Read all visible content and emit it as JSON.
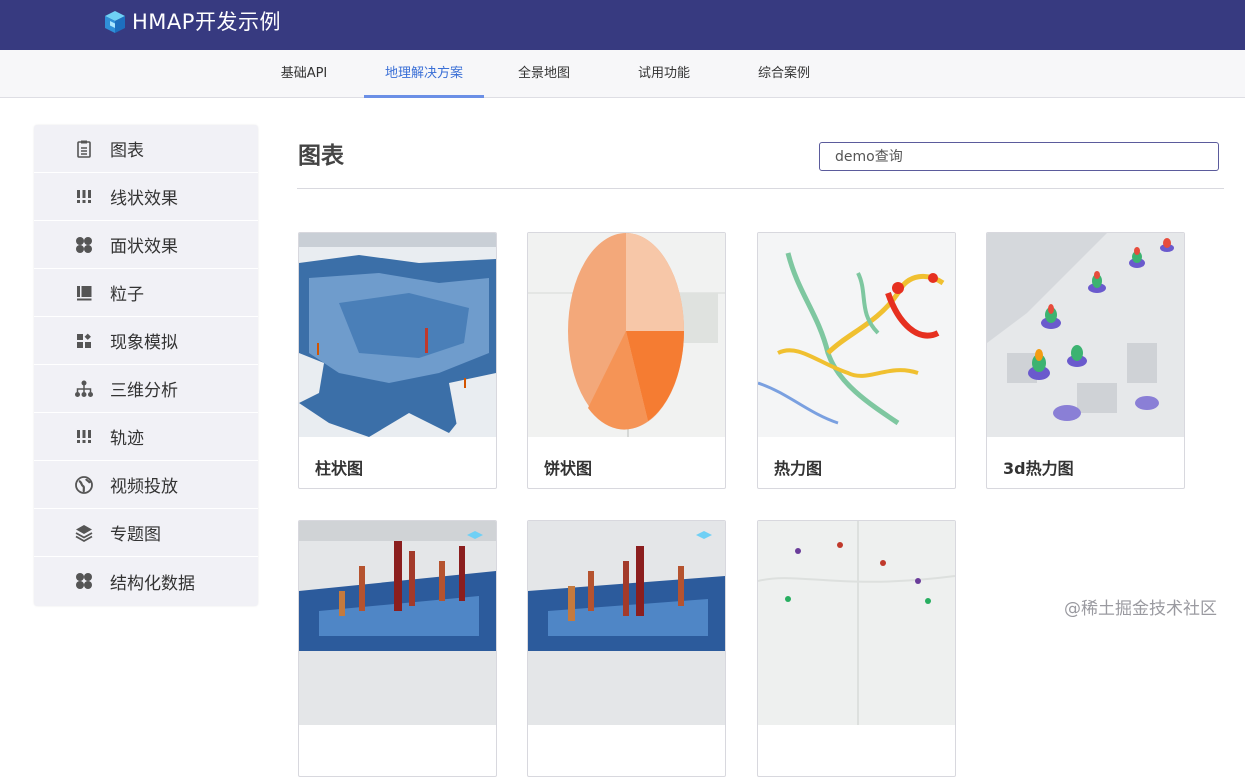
{
  "header": {
    "logo_icon": "cube-logo-icon",
    "title": "HMAP开发示例",
    "brand_color": "#373a80"
  },
  "nav": {
    "tabs": [
      {
        "label": "基础API",
        "active": false
      },
      {
        "label": "地理解决方案",
        "active": true
      },
      {
        "label": "全景地图",
        "active": false
      },
      {
        "label": "试用功能",
        "active": false
      },
      {
        "label": "综合案例",
        "active": false
      }
    ],
    "active_color": "#3a6fd6"
  },
  "sidebar": {
    "items": [
      {
        "label": "图表",
        "icon": "clipboard-icon"
      },
      {
        "label": "线状效果",
        "icon": "dots-grid-icon"
      },
      {
        "label": "面状效果",
        "icon": "clover-icon"
      },
      {
        "label": "粒子",
        "icon": "list-icon"
      },
      {
        "label": "现象模拟",
        "icon": "widgets-icon"
      },
      {
        "label": "三维分析",
        "icon": "hierarchy-icon"
      },
      {
        "label": "轨迹",
        "icon": "dots-grid-icon"
      },
      {
        "label": "视频投放",
        "icon": "globe-icon"
      },
      {
        "label": "专题图",
        "icon": "layers-icon"
      },
      {
        "label": "结构化数据",
        "icon": "clover-icon"
      }
    ]
  },
  "main": {
    "title": "图表",
    "search_placeholder": "demo查询",
    "cards": [
      {
        "label": "柱状图",
        "thumb": "bar-map-thumbnail"
      },
      {
        "label": "饼状图",
        "thumb": "pie-map-thumbnail"
      },
      {
        "label": "热力图",
        "thumb": "heat-map-thumbnail"
      },
      {
        "label": "3d热力图",
        "thumb": "3d-heat-map-thumbnail"
      },
      {
        "label": "",
        "thumb": "3d-bar-city-thumbnail"
      },
      {
        "label": "",
        "thumb": "3d-bar-city-thumbnail-2"
      },
      {
        "label": "",
        "thumb": "scatter-point-map-thumbnail"
      }
    ]
  },
  "watermark": "@稀土掘金技术社区"
}
